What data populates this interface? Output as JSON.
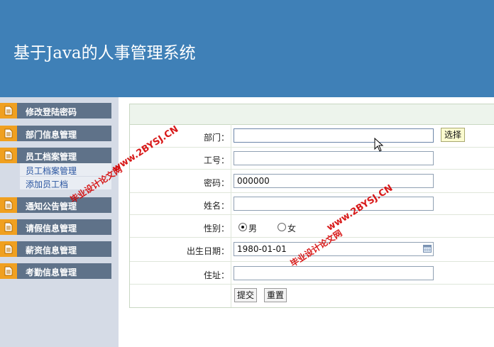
{
  "header": {
    "title": "基于Java的人事管理系统"
  },
  "sidebar": {
    "items": [
      {
        "label": "修改登陆密码"
      },
      {
        "label": "部门信息管理"
      },
      {
        "label": "员工档案管理",
        "subitems": [
          "员工档案管理",
          "添加员工档"
        ]
      },
      {
        "label": "通知公告管理"
      },
      {
        "label": "请假信息管理"
      },
      {
        "label": "薪资信息管理"
      },
      {
        "label": "考勤信息管理"
      }
    ]
  },
  "form": {
    "department_label": "部门：",
    "department_value": "",
    "choose_button": "选择",
    "employee_no_label": "工号：",
    "employee_no_value": "",
    "password_label": "密码：",
    "password_value": "000000",
    "name_label": "姓名：",
    "name_value": "",
    "gender_label": "性别：",
    "gender_options": [
      "男",
      "女"
    ],
    "gender_selected": "男",
    "birthdate_label": "出生日期：",
    "birthdate_value": "1980-01-01",
    "address_label": "住址：",
    "address_value": "",
    "submit_button": "提交",
    "reset_button": "重置"
  },
  "watermarks": [
    "www.2BYSJ.CN",
    "毕业设计论文网"
  ],
  "colors": {
    "header": "#3f80b7",
    "menu": "#5f7289",
    "menu_icon": "#f0a020",
    "sidebar_bg": "#d5dbe6"
  }
}
